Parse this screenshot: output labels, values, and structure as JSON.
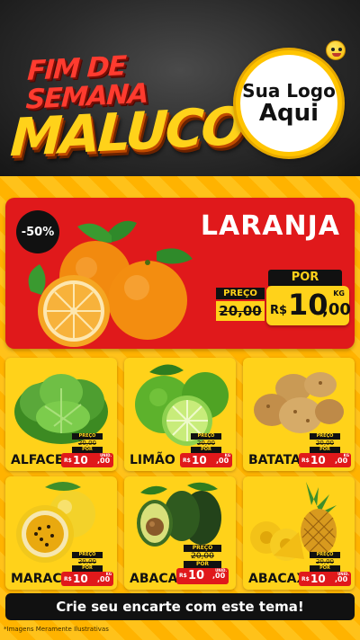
{
  "header": {
    "title_line1": "FIM DE SEMANA",
    "title_line2": "MALUCO",
    "logo_line1": "Sua Logo",
    "logo_line2": "Aqui"
  },
  "featured": {
    "discount": "-50%",
    "name": "LARANJA",
    "por_label": "POR",
    "preco_label": "PREÇO",
    "old_price": "20,00",
    "currency": "R$",
    "price_int": "10",
    "price_dec": ",00",
    "unit": "KG"
  },
  "products": [
    {
      "name": "ALFACE",
      "preco_label": "PREÇO",
      "old_price": "20,00",
      "por_label": "POR",
      "currency": "R$",
      "price_int": "10",
      "price_dec": ",00",
      "unit": "UNID."
    },
    {
      "name": "LIMÃO",
      "preco_label": "PREÇO",
      "old_price": "20,00",
      "por_label": "POR",
      "currency": "R$",
      "price_int": "10",
      "price_dec": ",00",
      "unit": "KG"
    },
    {
      "name": "BATATA",
      "preco_label": "PREÇO",
      "old_price": "20,00",
      "por_label": "POR",
      "currency": "R$",
      "price_int": "10",
      "price_dec": ",00",
      "unit": "KG"
    },
    {
      "name": "MARACUJÁ",
      "preco_label": "PREÇO",
      "old_price": "20,00",
      "por_label": "POR",
      "currency": "R$",
      "price_int": "10",
      "price_dec": ",00",
      "unit": "KG"
    },
    {
      "name": "ABACATE",
      "preco_label": "PREÇO",
      "old_price": "20,00",
      "por_label": "POR",
      "currency": "R$",
      "price_int": "10",
      "price_dec": ",00",
      "unit": "UNID."
    },
    {
      "name": "ABACAXI",
      "preco_label": "PREÇO",
      "old_price": "20,00",
      "por_label": "POR",
      "currency": "R$",
      "price_int": "10",
      "price_dec": ",00",
      "unit": "UNID."
    }
  ],
  "cta": {
    "label": "Crie seu encarte com este tema!"
  },
  "footer": {
    "disclaimer": "*Imagens Meramente Ilustrativas"
  },
  "icons": {
    "emoji": "emoji-icon",
    "orange": "orange-icon",
    "lettuce": "lettuce-icon",
    "lime": "lime-icon",
    "potato": "potato-icon",
    "passionfruit": "passionfruit-icon",
    "avocado": "avocado-icon",
    "pineapple": "pineapple-icon"
  },
  "colors": {
    "header_bg": "#2a2a2a",
    "title_red": "#ff3b2f",
    "title_yellow": "#ffd21a",
    "card_yellow": "#ffd21a",
    "stripe_orange": "#ffb300",
    "featured_red": "#e0191b",
    "black": "#111111"
  }
}
